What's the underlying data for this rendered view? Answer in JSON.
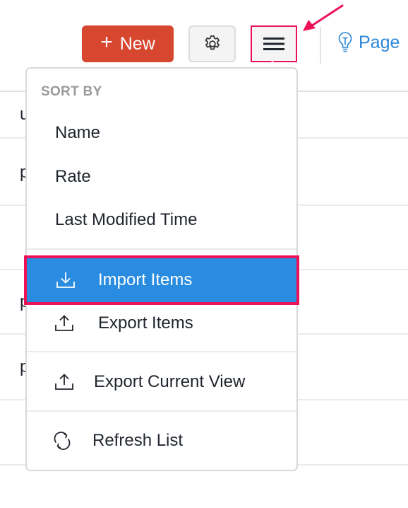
{
  "toolbar": {
    "new_label": "New",
    "new_icon": "plus-icon",
    "settings_icon": "gear-icon",
    "menu_icon": "hamburger-icon",
    "page_tips_label": "Page",
    "page_tips_icon": "lightbulb-icon"
  },
  "background_rows": [
    {
      "stub": "u"
    },
    {
      "stub": "p"
    },
    {
      "stub": ""
    },
    {
      "stub": "p"
    },
    {
      "stub": "p"
    },
    {
      "stub": ""
    }
  ],
  "dropdown": {
    "sort_heading": "SORT BY",
    "sort_options": [
      {
        "label": "Name"
      },
      {
        "label": "Rate"
      },
      {
        "label": "Last Modified Time"
      }
    ],
    "actions": [
      {
        "label": "Import Items",
        "icon": "download-icon",
        "highlighted": true
      },
      {
        "label": "Export Items",
        "icon": "upload-icon",
        "highlighted": false
      },
      {
        "label": "Export Current View",
        "icon": "upload-icon",
        "highlighted": false
      },
      {
        "label": "Refresh List",
        "icon": "refresh-icon",
        "highlighted": false
      }
    ]
  },
  "colors": {
    "new_button": "#d7472f",
    "highlight": "#2a8ce0",
    "annotation": "#ec1257",
    "link": "#2a87d8"
  }
}
